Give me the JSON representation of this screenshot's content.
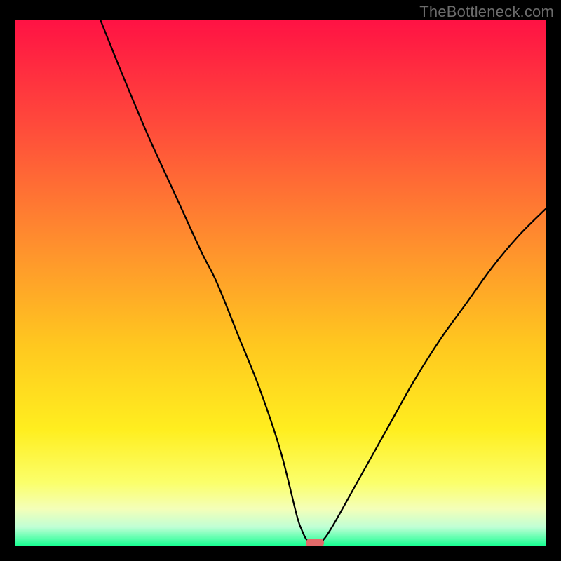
{
  "watermark": "TheBottleneck.com",
  "chart_data": {
    "type": "line",
    "title": "",
    "xlabel": "",
    "ylabel": "",
    "xlim": [
      0,
      100
    ],
    "ylim": [
      0,
      100
    ],
    "series": [
      {
        "name": "curve",
        "x": [
          16,
          20,
          25,
          30,
          35,
          38,
          42,
          46,
          50,
          53,
          54,
          55,
          56,
          57,
          58,
          60,
          65,
          70,
          75,
          80,
          85,
          90,
          95,
          100
        ],
        "y": [
          100,
          90,
          78,
          67,
          56,
          50,
          40,
          30,
          18,
          6,
          3,
          1,
          0.5,
          0.5,
          1,
          4,
          13,
          22,
          31,
          39,
          46,
          53,
          59,
          64
        ]
      }
    ],
    "marker": {
      "x": 56.5,
      "y": 0.5
    },
    "gradient_bands": [
      {
        "stop": 0.0,
        "color": "#ff1244"
      },
      {
        "stop": 0.2,
        "color": "#ff4a3b"
      },
      {
        "stop": 0.42,
        "color": "#ff8d2e"
      },
      {
        "stop": 0.62,
        "color": "#ffc81f"
      },
      {
        "stop": 0.78,
        "color": "#ffee1f"
      },
      {
        "stop": 0.88,
        "color": "#fbff6a"
      },
      {
        "stop": 0.93,
        "color": "#f4ffb8"
      },
      {
        "stop": 0.965,
        "color": "#bfffd5"
      },
      {
        "stop": 1.0,
        "color": "#1aff93"
      }
    ]
  }
}
